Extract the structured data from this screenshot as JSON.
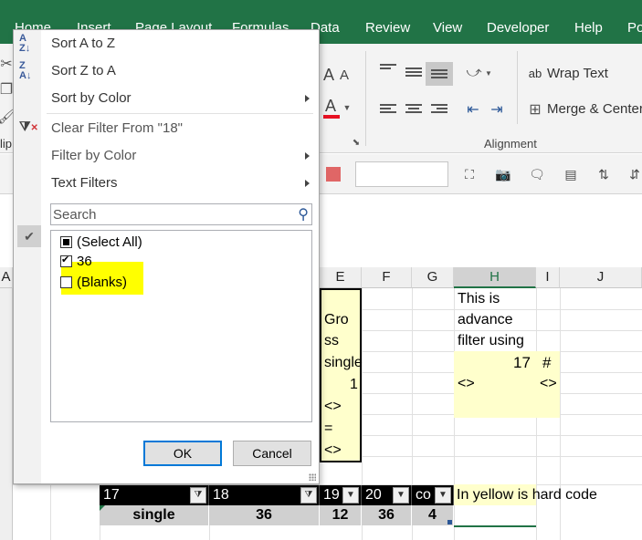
{
  "ribbon": {
    "tabs": [
      "Home",
      "Insert",
      "Page Layout",
      "Formulas",
      "Data",
      "Review",
      "View",
      "Developer",
      "Help",
      "Po"
    ],
    "wrap_text": "Wrap Text",
    "merge_center": "Merge & Center",
    "alignment_group": "Alignment",
    "clipboard_fragment": "lip",
    "font_size_up": "A",
    "font_size_down": "A",
    "font_color": "A",
    "font_color_hex": "#e81123"
  },
  "grid": {
    "columns": [
      "A",
      "E",
      "F",
      "G",
      "H",
      "I",
      "J"
    ],
    "selected_column": "H",
    "cell_e": [
      "Gro",
      "ss",
      "single",
      "1",
      "<>",
      "=",
      "<>"
    ],
    "cell_h": [
      "This is",
      "advance",
      "filter using"
    ],
    "cell_h_value": "17",
    "cell_i_value": "#",
    "cell_h_neq": "<>",
    "cell_i_neq": "<>",
    "note": "In yellow is hard code",
    "table_headers": [
      "17",
      "18",
      "19",
      "20",
      "co"
    ],
    "table_values": [
      "single",
      "36",
      "12",
      "36",
      "4"
    ],
    "yellow_hex": "#ffffcc"
  },
  "filter_menu": {
    "sort_az": "Sort A to Z",
    "sort_za": "Sort Z to A",
    "sort_color": "Sort by Color",
    "clear_filter": "Clear Filter From \"18\"",
    "filter_color": "Filter by Color",
    "text_filters": "Text Filters",
    "search_placeholder": "Search",
    "list": [
      {
        "label": "(Select All)",
        "state": "partial"
      },
      {
        "label": "36",
        "state": "checked"
      },
      {
        "label": "(Blanks)",
        "state": "unchecked"
      }
    ],
    "ok": "OK",
    "cancel": "Cancel",
    "highlight_hex": "#ffff00"
  }
}
